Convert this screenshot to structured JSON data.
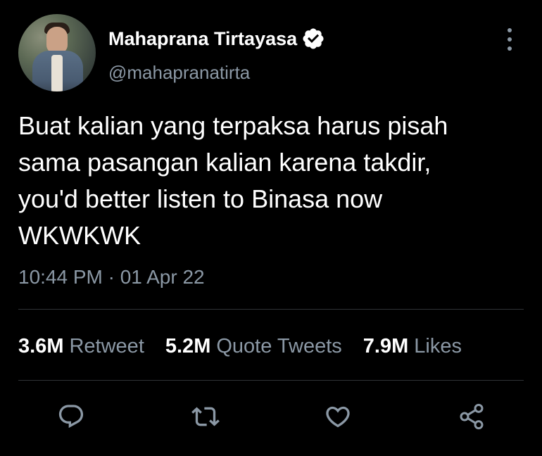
{
  "tweet": {
    "author": {
      "name": "Mahaprana Tirtayasa",
      "handle": "@mahapranatirta",
      "verified": true
    },
    "text_lines": [
      "Buat kalian yang terpaksa harus pisah",
      "sama pasangan kalian karena takdir,",
      "you'd better listen to Binasa now",
      "WKWKWK"
    ],
    "timestamp": "10:44 PM · 01 Apr 22",
    "stats": [
      {
        "count": "3.6M",
        "label": "Retweet"
      },
      {
        "count": "5.2M",
        "label": "Quote Tweets"
      },
      {
        "count": "7.9M",
        "label": "Likes"
      }
    ],
    "actions": [
      "reply-icon",
      "retweet-icon",
      "like-icon",
      "share-icon"
    ]
  },
  "colors": {
    "background": "#000000",
    "primary_text": "#ffffff",
    "secondary_text": "#8b98a5",
    "divider": "#2f3336",
    "icon": "#8b98a5"
  }
}
